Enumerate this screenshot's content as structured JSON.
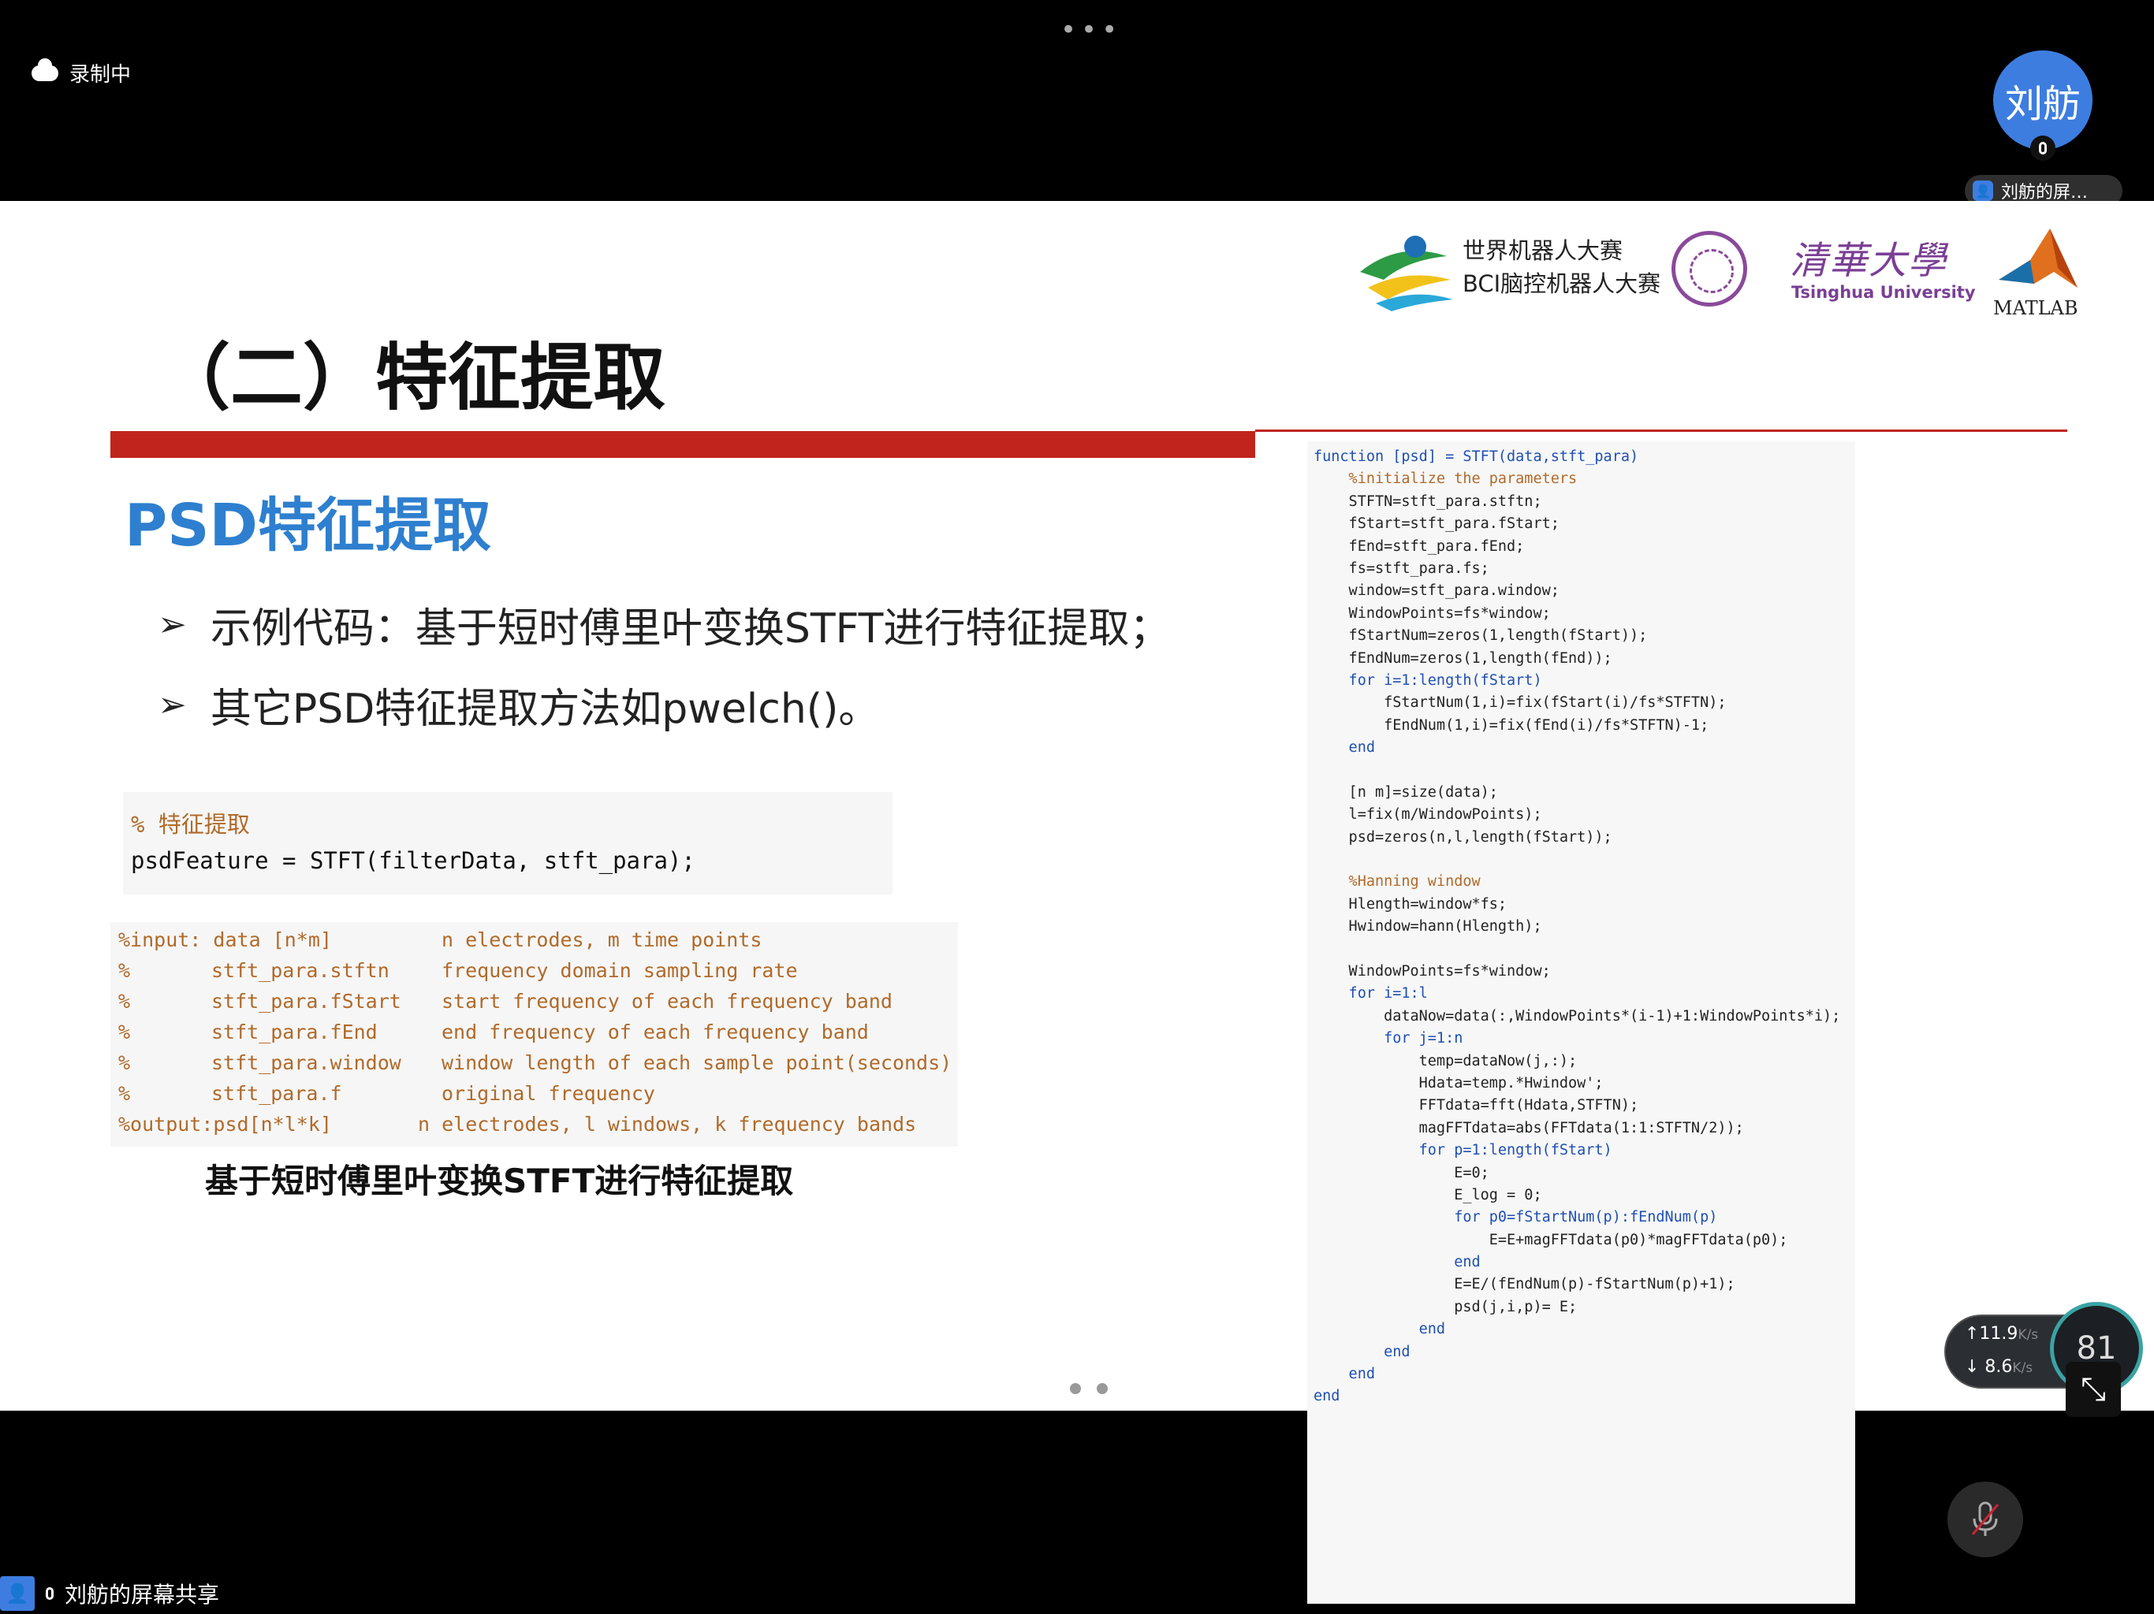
{
  "top_bar": {
    "more_dots": "•••",
    "recording_label": "录制中",
    "avatar_text": "刘舫",
    "sharer_tag": "刘舫的屏…"
  },
  "slide": {
    "title": "（二）特征提取",
    "logos": {
      "competition_line1": "世界机器人大赛",
      "competition_line2": "BCI脑控机器人大赛",
      "tsinghua_cn": "清華大學",
      "tsinghua_en": "Tsinghua University",
      "matlab": "MATLAB"
    },
    "heading": "PSD特征提取",
    "bullets": [
      "示例代码：基于短时傅里叶变换STFT进行特征提取；",
      "其它PSD特征提取方法如pwelch()。"
    ],
    "code_small": {
      "comment": "% 特征提取",
      "line": "psdFeature = STFT(filterData, stft_para);"
    },
    "arg_table": [
      [
        "%input: data [n*m]",
        "",
        "n electrodes, m time points"
      ],
      [
        "%",
        "stft_para.stftn",
        "frequency domain sampling rate"
      ],
      [
        "%",
        "stft_para.fStart",
        "start frequency of each frequency band"
      ],
      [
        "%",
        "stft_para.fEnd",
        "end frequency of each frequency band"
      ],
      [
        "%",
        "stft_para.window",
        "window length of each sample point(seconds)"
      ],
      [
        "%",
        "stft_para.f",
        "original frequency"
      ],
      [
        "%output:psd[n*l*k]",
        "",
        "n electrodes, l windows, k frequency bands"
      ]
    ],
    "caption": "基于短时傅里叶变换STFT进行特征提取",
    "code_right": [
      "function [psd] = STFT(data,stft_para)",
      "    %initialize the parameters",
      "    STFTN=stft_para.stftn;",
      "    fStart=stft_para.fStart;",
      "    fEnd=stft_para.fEnd;",
      "    fs=stft_para.fs;",
      "    window=stft_para.window;",
      "    WindowPoints=fs*window;",
      "    fStartNum=zeros(1,length(fStart));",
      "    fEndNum=zeros(1,length(fEnd));",
      "    for i=1:length(fStart)",
      "        fStartNum(1,i)=fix(fStart(i)/fs*STFTN);",
      "        fEndNum(1,i)=fix(fEnd(i)/fs*STFTN)-1;",
      "    end",
      "",
      "    [n m]=size(data);",
      "    l=fix(m/WindowPoints);",
      "    psd=zeros(n,l,length(fStart));",
      "",
      "    %Hanning window",
      "    Hlength=window*fs;",
      "    Hwindow=hann(Hlength);",
      "",
      "    WindowPoints=fs*window;",
      "    for i=1:l",
      "        dataNow=data(:,WindowPoints*(i-1)+1:WindowPoints*i);",
      "        for j=1:n",
      "            temp=dataNow(j,:);",
      "            Hdata=temp.*Hwindow';",
      "            FFTdata=fft(Hdata,STFTN);",
      "            magFFTdata=abs(FFTdata(1:1:STFTN/2));",
      "            for p=1:length(fStart)",
      "                E=0;",
      "                E_log = 0;",
      "                for p0=fStartNum(p):fEndNum(p)",
      "                    E=E+magFFTdata(p0)*magFFTdata(p0);",
      "                end",
      "                E=E/(fEndNum(p)-fStartNum(p)+1);",
      "                psd(j,i,p)= E;",
      "            end",
      "        end",
      "    end",
      "end"
    ]
  },
  "net_widget": {
    "up": "↑11.9",
    "down": "↓ 8.6",
    "unit": "K/s",
    "gauge": "81"
  },
  "bottom": {
    "status": "刘舫的屏幕共享"
  },
  "colors": {
    "accent_red": "#c0241d",
    "heading_blue": "#2e7fcf",
    "comment_brown": "#b06a2a",
    "keyword_blue": "#1f4fb3",
    "avatar_blue": "#3d7de0"
  }
}
